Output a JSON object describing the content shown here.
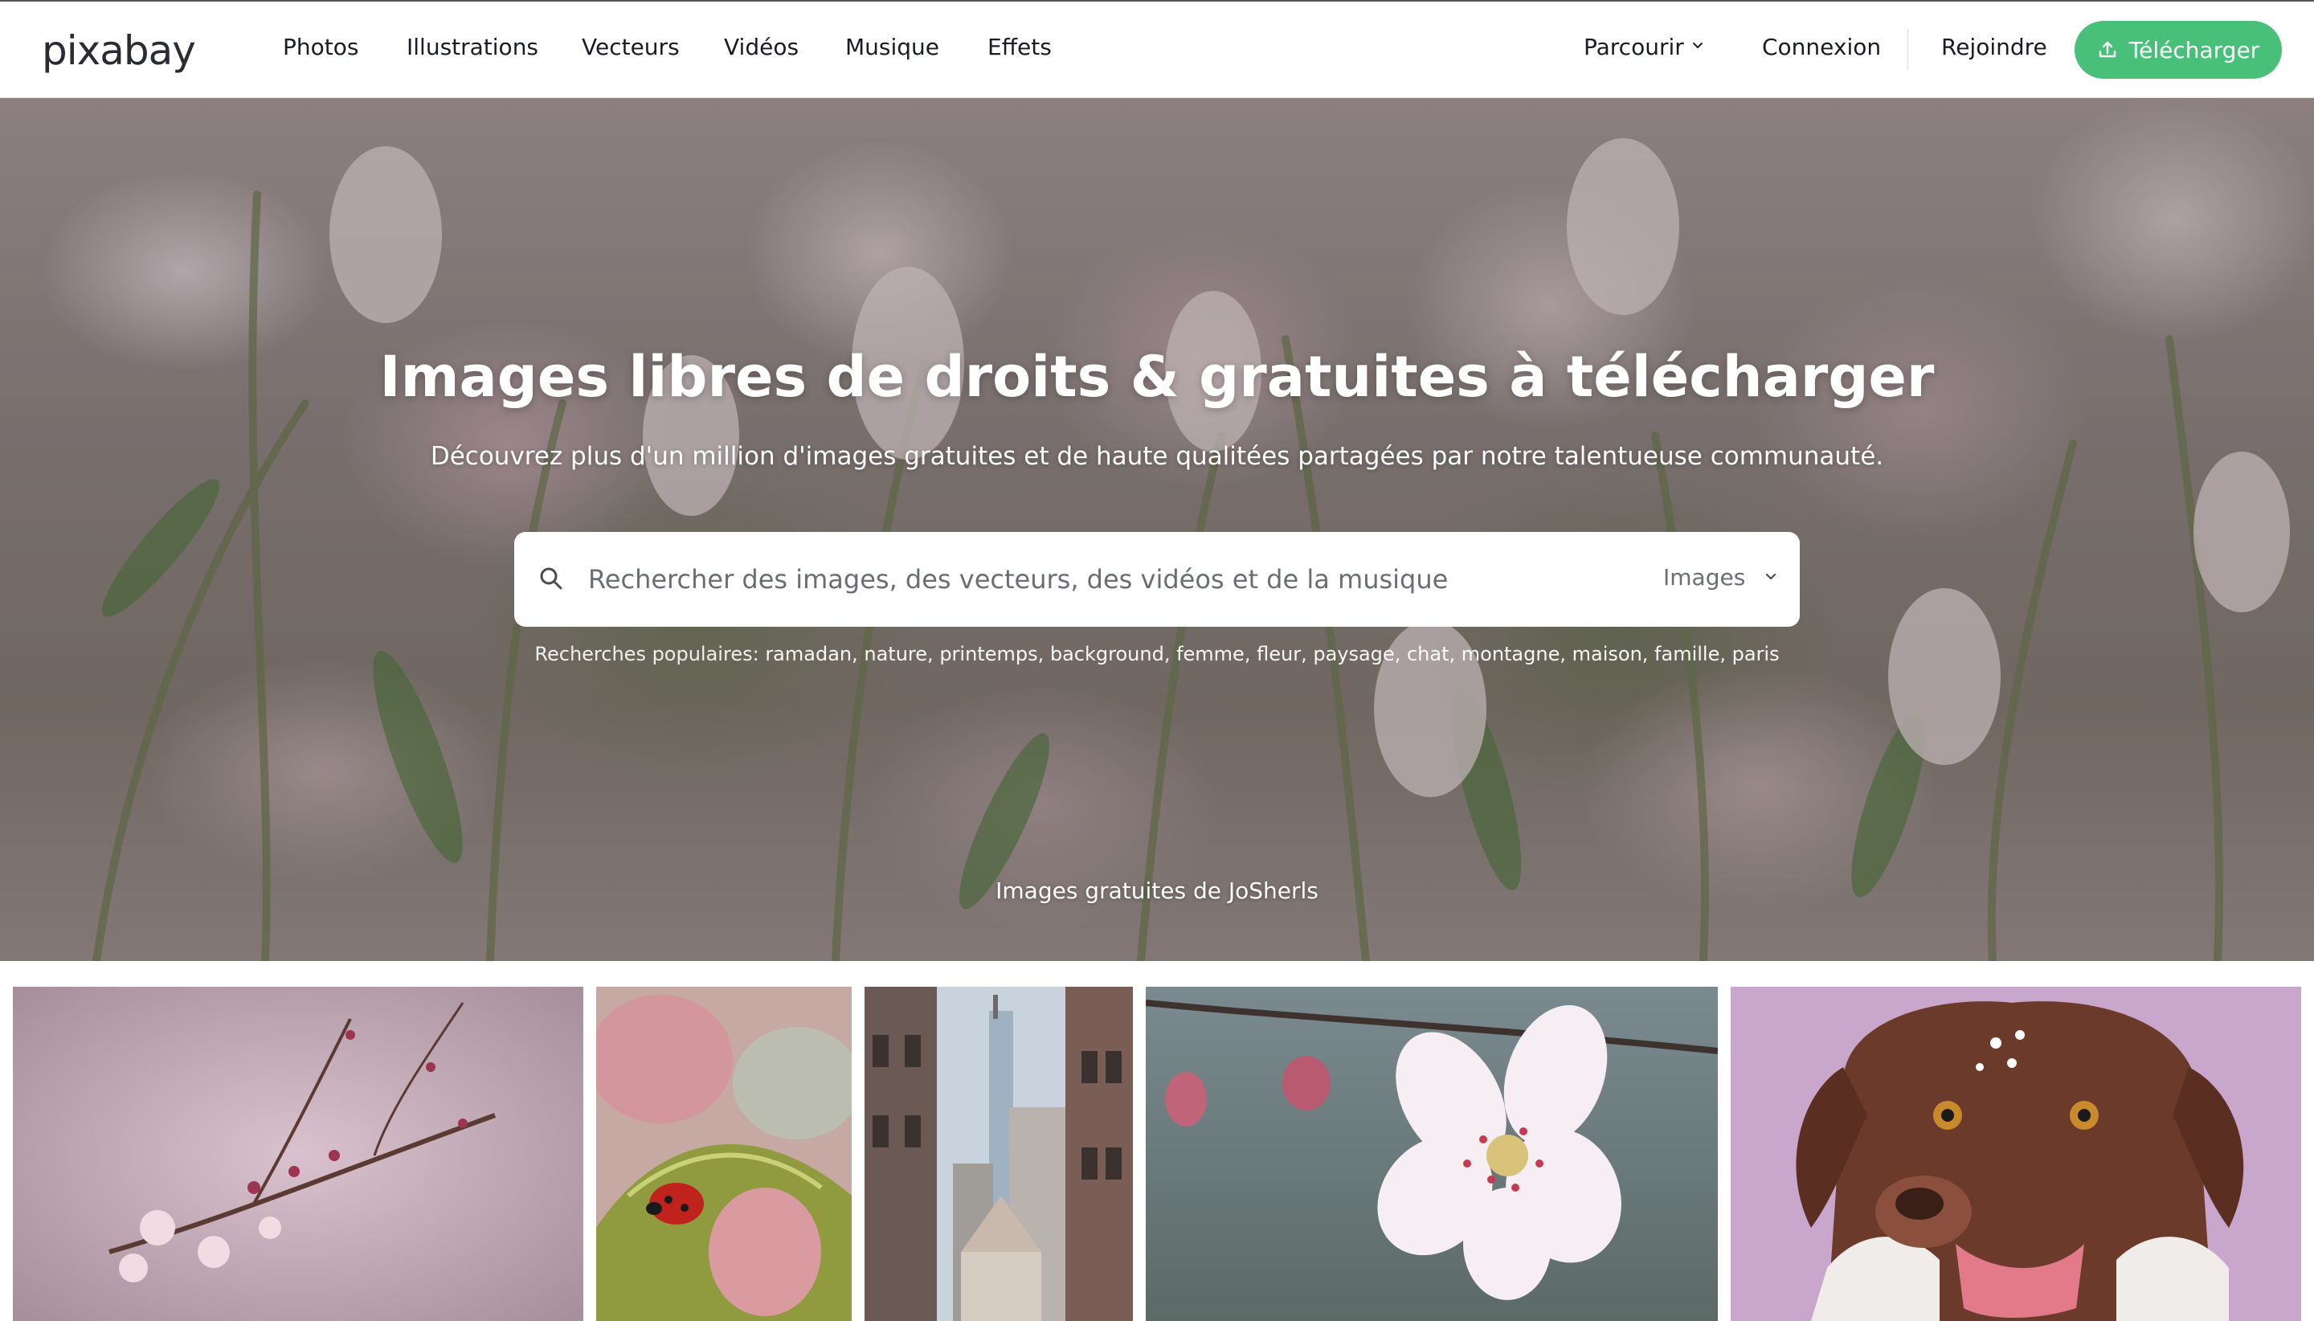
{
  "header": {
    "logo": "pixabay",
    "nav": [
      "Photos",
      "Illustrations",
      "Vecteurs",
      "Vidéos",
      "Musique",
      "Effets"
    ],
    "browse_label": "Parcourir",
    "login_label": "Connexion",
    "join_label": "Rejoindre",
    "upload_label": "Télécharger"
  },
  "hero": {
    "title": "Images libres de droits & gratuites à télécharger",
    "subtitle": "Découvrez plus d'un million d'images gratuites et de haute qualitées partagées par notre talentueuse communauté.",
    "search": {
      "placeholder": "Rechercher des images, des vecteurs, des vidéos et de la musique",
      "type_label": "Images"
    },
    "popular_label": "Recherches populaires:",
    "popular_tags": [
      "ramadan",
      "nature",
      "printemps",
      "background",
      "femme",
      "fleur",
      "paysage",
      "chat",
      "montagne",
      "maison",
      "famille",
      "paris"
    ],
    "credit": "Images gratuites de JoSherls"
  },
  "colors": {
    "accent": "#48c07a",
    "text": "#191b26",
    "muted": "#6b6d74"
  }
}
